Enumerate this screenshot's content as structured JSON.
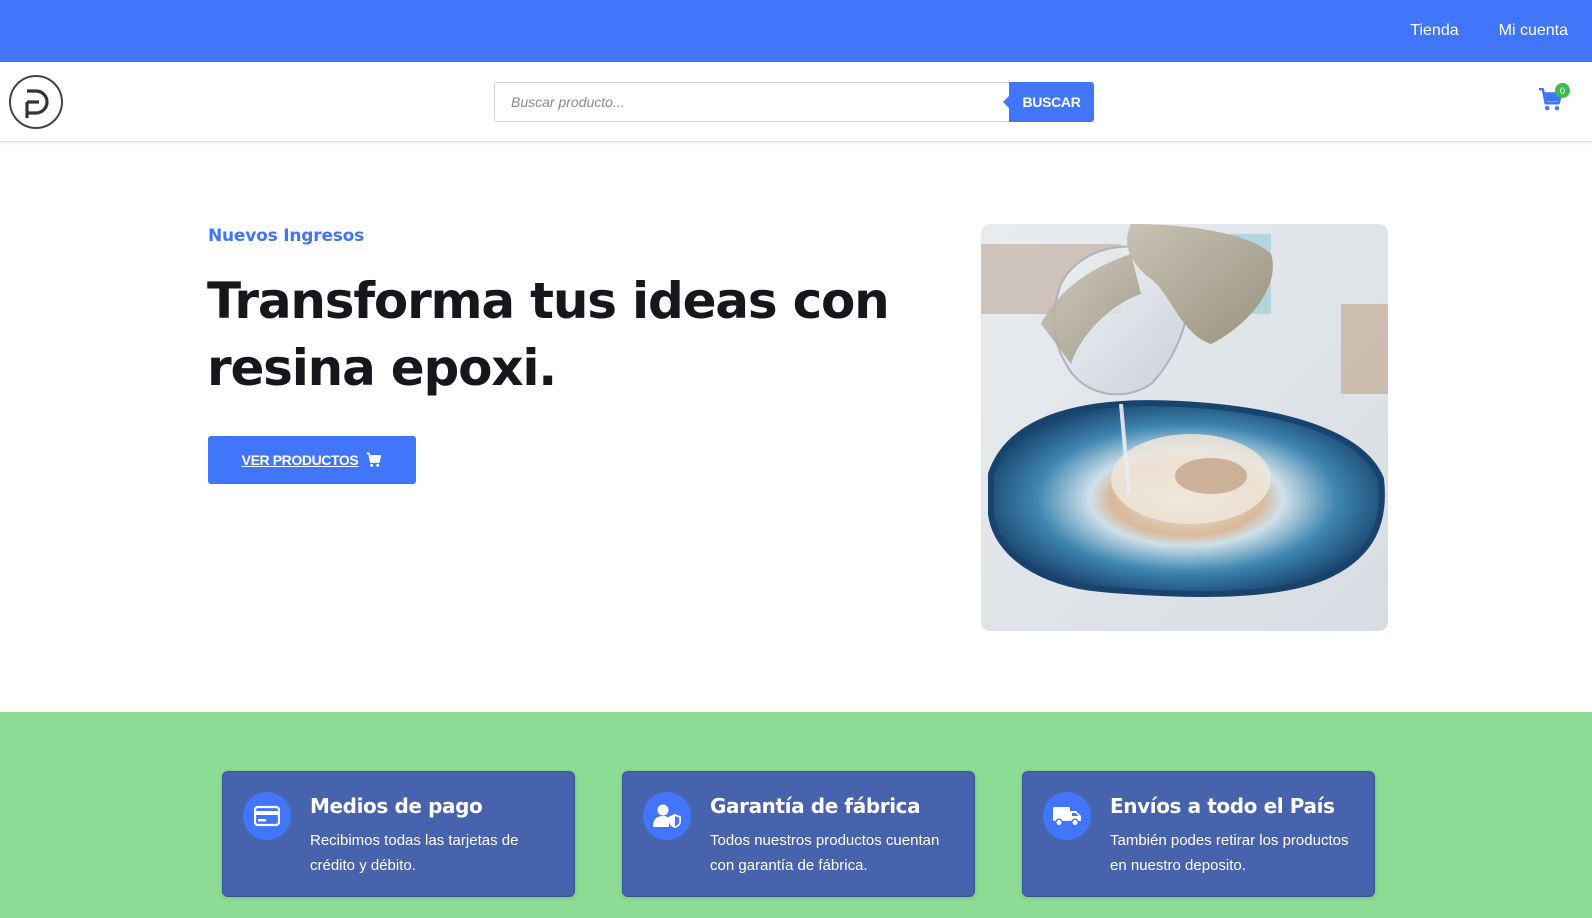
{
  "topnav": {
    "items": [
      "Tienda",
      "Mi cuenta"
    ]
  },
  "header": {
    "logo_icon": "brand-logo",
    "search": {
      "placeholder": "Buscar producto...",
      "button_label": "BUSCAR"
    },
    "cart": {
      "icon": "cart-icon",
      "count": "0"
    }
  },
  "hero": {
    "eyebrow": "Nuevos Ingresos",
    "title": "Transforma tus ideas con resina epoxi.",
    "button_label": "VER PRODUCTOS",
    "button_icon": "cart-icon",
    "image": "resin-pouring-photo"
  },
  "features": [
    {
      "icon": "credit-card-icon",
      "title": "Medios de pago",
      "text": "Recibimos todas las tarjetas de crédito y débito."
    },
    {
      "icon": "user-shield-icon",
      "title": "Garantía de fábrica",
      "text": "Todos nuestros productos cuentan con garantía de fábrica."
    },
    {
      "icon": "truck-icon",
      "title": "Envíos a todo el País",
      "text": "También podes retirar los productos en nuestro deposito."
    }
  ],
  "colors": {
    "primary": "#4176fb",
    "features_bg": "#8cdc95",
    "card_bg": "#4863ad",
    "badge": "#3dbb51"
  }
}
